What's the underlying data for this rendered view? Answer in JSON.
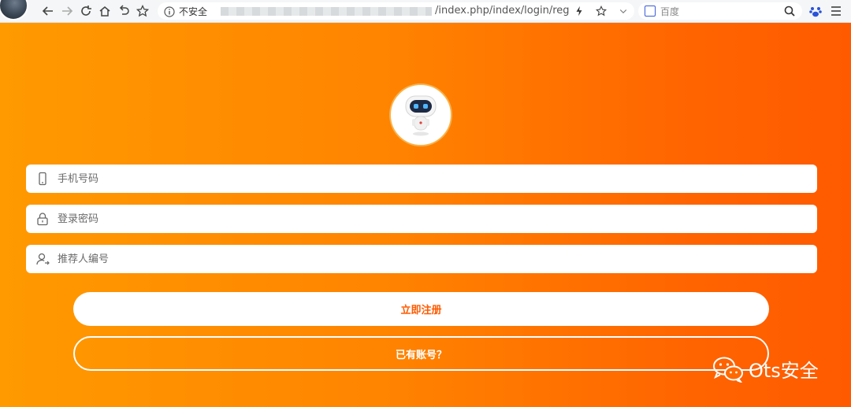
{
  "browser": {
    "url_security_label": "不安全",
    "url_path": "/index.php/index/login/reg",
    "search_placeholder": "百度"
  },
  "form": {
    "phone_placeholder": "手机号码",
    "password_placeholder": "登录密码",
    "referrer_placeholder": "推荐人编号"
  },
  "actions": {
    "register_label": "立即注册",
    "have_account_label": "已有账号？"
  },
  "watermark": {
    "text": "Ots安全"
  },
  "icons": {
    "back": "arrow-left-icon",
    "forward": "arrow-right-icon",
    "reload": "reload-icon",
    "home": "home-icon",
    "undo": "undo-icon",
    "favorite": "star-icon",
    "info": "info-icon",
    "flash": "lightning-icon",
    "bookmark": "star-icon",
    "dropdown": "chevron-down-icon",
    "search": "search-icon",
    "paw": "paw-icon",
    "menu": "menu-icon",
    "phone": "phone-icon",
    "lock": "lock-icon",
    "user": "user-icon",
    "wechat": "wechat-icon"
  },
  "colors": {
    "gradient_start": "#ff9a00",
    "gradient_end": "#ff5a00",
    "primary_text": "#ff5a00"
  }
}
